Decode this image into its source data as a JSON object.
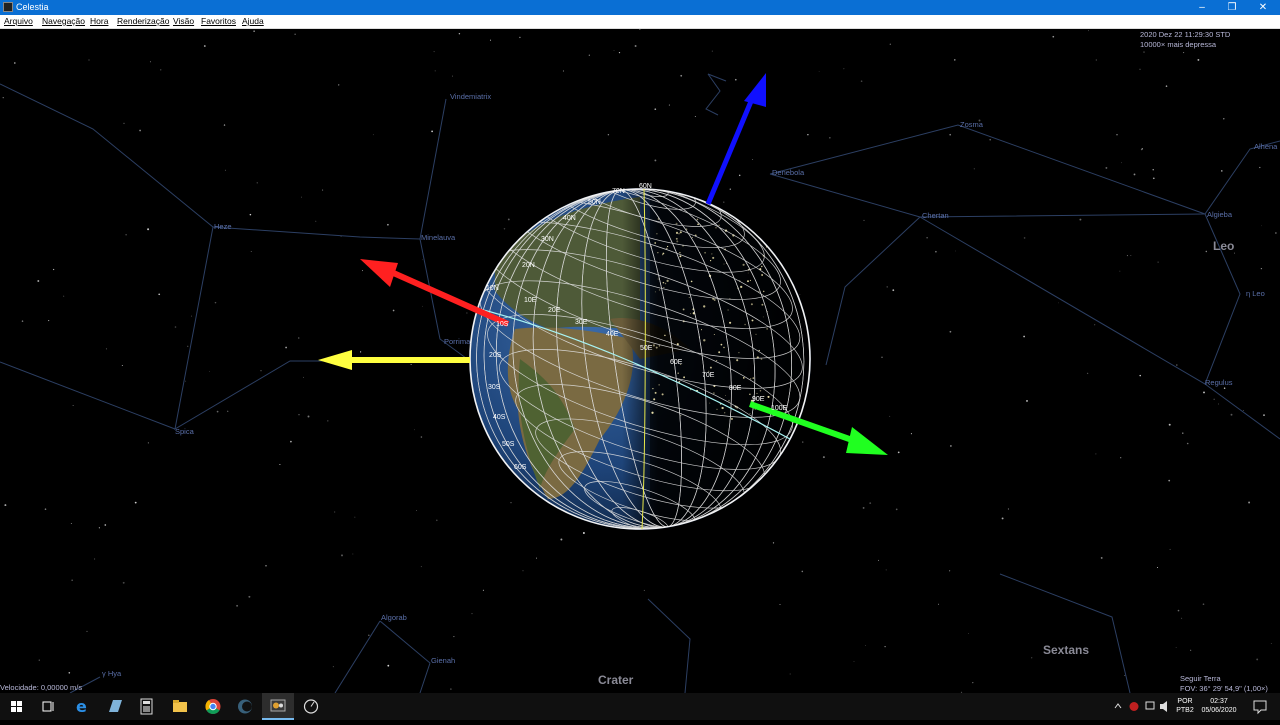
{
  "window": {
    "title": "Celestia"
  },
  "menu": [
    "Arquivo",
    "Navegação",
    "Hora",
    "Renderização",
    "Visão",
    "Favoritos",
    "Ajuda"
  ],
  "hud": {
    "datetime": "2020 Dez 22 11:29:30 STD",
    "time_rate": "10000× mais depressa",
    "velocity": "Velocidade: 0,00000 m/s",
    "follow": "Seguir Terra",
    "fov": "FOV: 36° 29' 54,9\" (1,00×)"
  },
  "stars": [
    "Vindemiatrix",
    "Zosma",
    "Denebola",
    "Chertan",
    "Algieba",
    "Alhena",
    "Heze",
    "Minelauva",
    "Porrima",
    "Spica",
    "Regulus",
    "Algorab",
    "Gienah",
    "γ Hya",
    "η Leo"
  ],
  "constellations": [
    "Leo",
    "Sextans",
    "Crater"
  ],
  "globe": {
    "lat_labels": [
      "70N",
      "60N",
      "50N",
      "40N",
      "30N",
      "20N",
      "10N",
      "0",
      "10S",
      "20S",
      "30S",
      "40S",
      "50S",
      "60S"
    ],
    "lon_labels": [
      "10E",
      "20E",
      "30E",
      "40E",
      "50E",
      "60E",
      "70E",
      "80E",
      "90E",
      "100E"
    ]
  },
  "taskbar": {
    "language": "POR",
    "layout": "PTB2",
    "time": "02:37",
    "date": "05/06/2020"
  },
  "colors": {
    "titlebar": "#0a6fd4",
    "axis_x": "#ff2020",
    "axis_y": "#20ff20",
    "axis_z": "#1010ff",
    "sun_direction": "#ffff40",
    "constellation_line": "#2c3f63"
  }
}
